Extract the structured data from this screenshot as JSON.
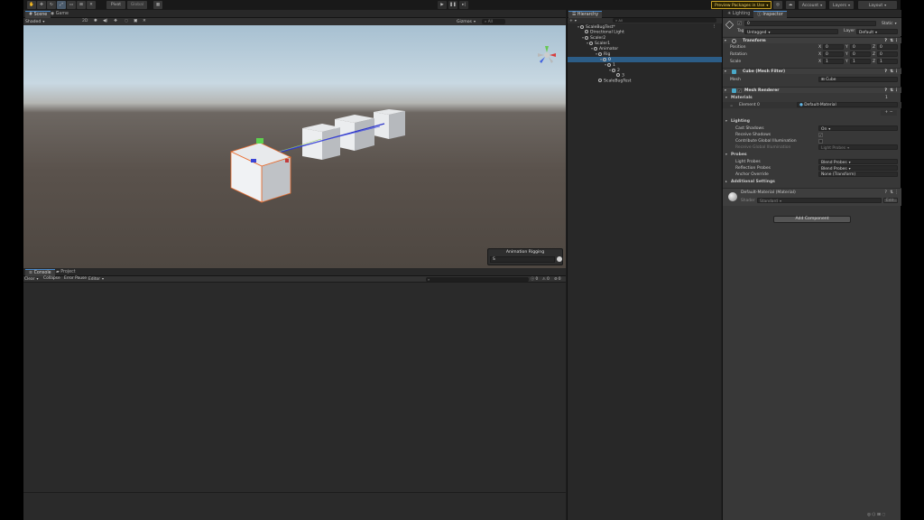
{
  "colors": {
    "selection": "#2c5d87",
    "accent": "#4a88c7",
    "preview_border": "#c9a227"
  },
  "toolbar": {
    "tools": [
      "hand-tool-icon",
      "move-tool-icon",
      "rotate-tool-icon",
      "scale-tool-icon",
      "rect-tool-icon",
      "transform-tool-icon",
      "custom-tool-icon"
    ],
    "pivot": "Pivot",
    "global": "Global",
    "preview_packages": "Preview Packages in Use",
    "account": "Account",
    "layers": "Layers",
    "layout": "Layout"
  },
  "scene": {
    "tabs": {
      "scene": "Scene",
      "game": "Game"
    },
    "shading": "Shaded",
    "gizmos": "Gizmos",
    "search_placeholder": "All",
    "overlay": {
      "title": "Animation Rigging",
      "value": "S"
    }
  },
  "console": {
    "tabs": {
      "console": "Console",
      "project": "Project"
    },
    "clear": "Clear",
    "collapse": "Collapse",
    "error_pause": "Error Pause",
    "editor": "Editor",
    "counts": {
      "info": "0",
      "warn": "0",
      "error": "0"
    }
  },
  "hierarchy": {
    "tab": "Hierarchy",
    "add": "+",
    "search_placeholder": "All",
    "items": [
      {
        "label": "ScaleBugTest*",
        "depth": 0,
        "arrow": "▾"
      },
      {
        "label": "Directional Light",
        "depth": 1,
        "arrow": ""
      },
      {
        "label": "Scaler2",
        "depth": 1,
        "arrow": "▾"
      },
      {
        "label": "Scaler1",
        "depth": 2,
        "arrow": "▾"
      },
      {
        "label": "Animator",
        "depth": 3,
        "arrow": "▾"
      },
      {
        "label": "Rig",
        "depth": 4,
        "arrow": "▾"
      },
      {
        "label": "0",
        "depth": 5,
        "arrow": "▾",
        "selected": true
      },
      {
        "label": "1",
        "depth": 6,
        "arrow": "▾"
      },
      {
        "label": "2",
        "depth": 7,
        "arrow": "▾"
      },
      {
        "label": "3",
        "depth": 8,
        "arrow": ""
      },
      {
        "label": "ScaleBugTest",
        "depth": 4,
        "arrow": ""
      }
    ]
  },
  "inspector": {
    "tabs": {
      "lighting": "Lighting",
      "inspector": "Inspector"
    },
    "object_name": "0",
    "static": "Static",
    "tag_label": "Tag",
    "tag_value": "Untagged",
    "layer_label": "Layer",
    "layer_value": "Default",
    "transform": {
      "title": "Transform",
      "rows": [
        {
          "label": "Position",
          "x": "0",
          "y": "0",
          "z": "0"
        },
        {
          "label": "Rotation",
          "x": "0",
          "y": "0",
          "z": "0"
        },
        {
          "label": "Scale",
          "x": "1",
          "y": "1",
          "z": "1"
        }
      ]
    },
    "mesh_filter": {
      "title": "Cube (Mesh Filter)",
      "mesh_label": "Mesh",
      "mesh_value": "Cube"
    },
    "mesh_renderer": {
      "title": "Mesh Renderer",
      "materials_label": "Materials",
      "materials_count": "1",
      "element_label": "Element 0",
      "element_value": "Default-Material",
      "lighting_label": "Lighting",
      "cast_shadows_label": "Cast Shadows",
      "cast_shadows_value": "On",
      "receive_shadows_label": "Receive Shadows",
      "contribute_gi_label": "Contribute Global Illumination",
      "receive_gi_label": "Receive Global Illumination",
      "receive_gi_value": "Light Probes",
      "probes_label": "Probes",
      "light_probes_label": "Light Probes",
      "light_probes_value": "Blend Probes",
      "reflection_probes_label": "Reflection Probes",
      "reflection_probes_value": "Blend Probes",
      "anchor_override_label": "Anchor Override",
      "anchor_override_value": "None (Transform)",
      "additional_settings_label": "Additional Settings"
    },
    "material": {
      "title": "Default-Material (Material)",
      "shader_label": "Shader",
      "shader_value": "Standard",
      "edit": "Edit..."
    },
    "add_component": "Add Component"
  }
}
